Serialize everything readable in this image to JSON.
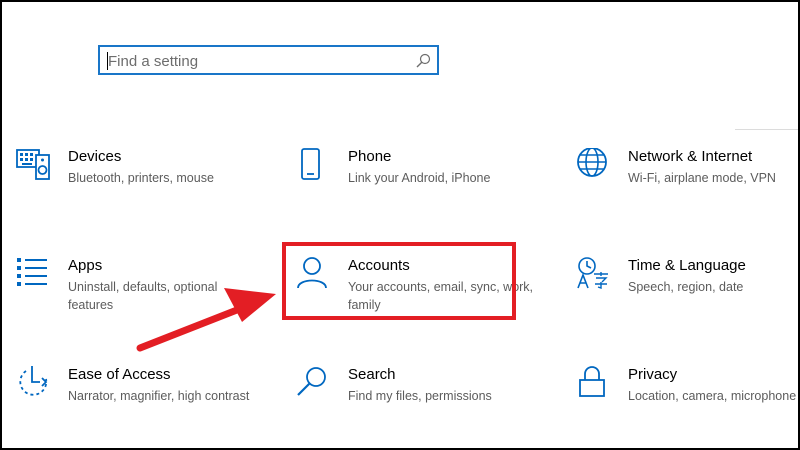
{
  "search": {
    "placeholder": "Find a setting"
  },
  "tiles": [
    {
      "title": "Devices",
      "desc": "Bluetooth, printers, mouse",
      "icon": "keyboard-speaker-icon"
    },
    {
      "title": "Phone",
      "desc": "Link your Android, iPhone",
      "icon": "phone-icon"
    },
    {
      "title": "Network & Internet",
      "desc": "Wi-Fi, airplane mode, VPN",
      "icon": "globe-icon"
    },
    {
      "title": "Apps",
      "desc": "Uninstall, defaults, optional features",
      "icon": "apps-list-icon"
    },
    {
      "title": "Accounts",
      "desc": "Your accounts, email, sync, work, family",
      "icon": "person-icon"
    },
    {
      "title": "Time & Language",
      "desc": "Speech, region, date",
      "icon": "time-language-icon"
    },
    {
      "title": "Ease of Access",
      "desc": "Narrator, magnifier, high contrast",
      "icon": "ease-of-access-icon"
    },
    {
      "title": "Search",
      "desc": "Find my files, permissions",
      "icon": "magnifier-icon"
    },
    {
      "title": "Privacy",
      "desc": "Location, camera, microphone",
      "icon": "lock-icon"
    }
  ],
  "colors": {
    "accent": "#0067c0",
    "highlight": "#e31e24"
  }
}
